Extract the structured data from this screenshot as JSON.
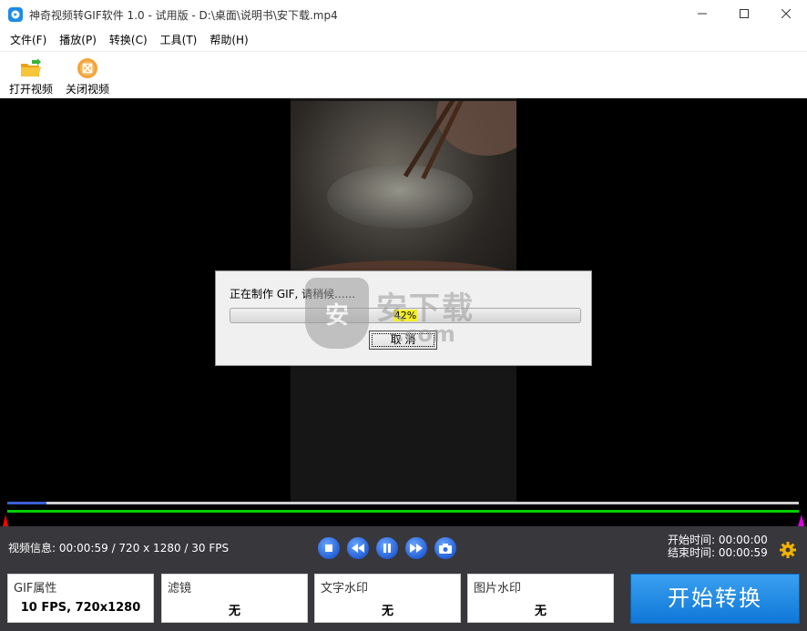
{
  "window": {
    "title": "神奇视频转GIF软件 1.0 - 试用版 - D:\\桌面\\说明书\\安下载.mp4"
  },
  "menu": [
    "文件(F)",
    "播放(P)",
    "转换(C)",
    "工具(T)",
    "帮助(H)"
  ],
  "toolbar": {
    "open_label": "打开视频",
    "close_label": "关闭视频"
  },
  "dialog": {
    "message": "正在制作 GIF, 请稍候......",
    "progress_text": "42%",
    "progress_value": 0.42,
    "cancel_label": "取 消"
  },
  "watermark": {
    "cn": "安下载",
    "en": ".com",
    "shield": "安"
  },
  "timeline": {
    "played_fraction": 0.05
  },
  "info": {
    "text": "视频信息: 00:00:59 / 720 x 1280 / 30 FPS"
  },
  "times": {
    "start": "开始时间: 00:00:00",
    "end": "结束时间: 00:00:59"
  },
  "panels": {
    "gif": {
      "title": "GIF属性",
      "value": "10 FPS, 720x1280"
    },
    "filter": {
      "title": "滤镜",
      "value": "无"
    },
    "text_wm": {
      "title": "文字水印",
      "value": "无"
    },
    "image_wm": {
      "title": "图片水印",
      "value": "无"
    }
  },
  "start_button": "开始转换",
  "colors": {
    "accent": "#1a86e0",
    "progress_highlight": "#f4ef2a",
    "range_bar": "#00d000",
    "played_bar": "#3b5fd6"
  }
}
